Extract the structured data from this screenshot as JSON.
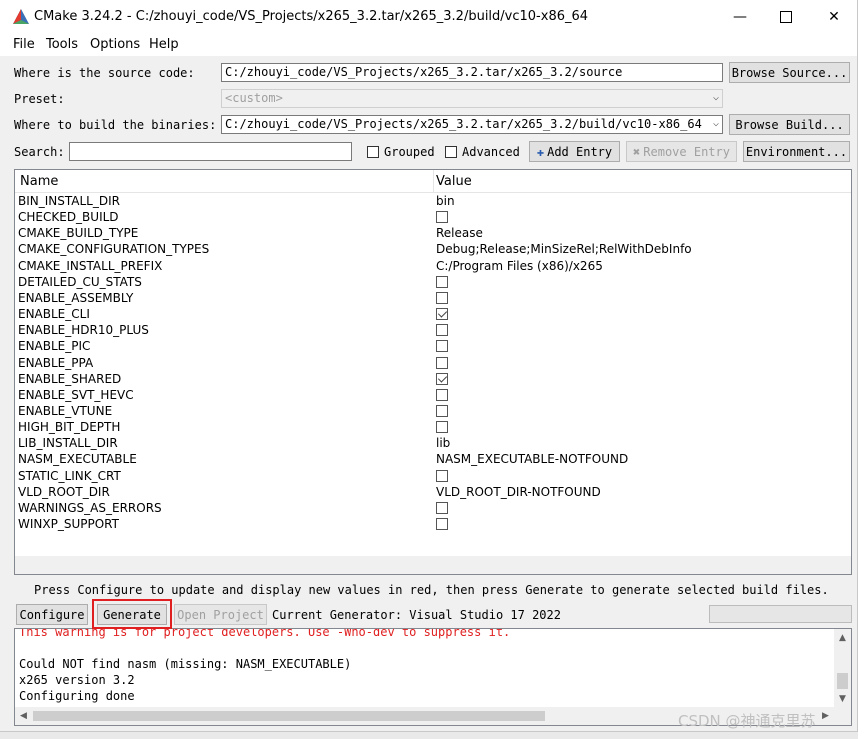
{
  "window": {
    "title": "CMake 3.24.2 - C:/zhouyi_code/VS_Projects/x265_3.2.tar/x265_3.2/build/vc10-x86_64"
  },
  "menu": [
    "File",
    "Tools",
    "Options",
    "Help"
  ],
  "source": {
    "label": "Where is the source code:",
    "value": "C:/zhouyi_code/VS_Projects/x265_3.2.tar/x265_3.2/source",
    "browse": "Browse Source..."
  },
  "preset": {
    "label": "Preset:",
    "value": "<custom>"
  },
  "build": {
    "label": "Where to build the binaries:",
    "value": "C:/zhouyi_code/VS_Projects/x265_3.2.tar/x265_3.2/build/vc10-x86_64",
    "browse": "Browse Build..."
  },
  "search": {
    "label": "Search:",
    "value": "",
    "grouped": "Grouped",
    "advanced": "Advanced",
    "add_entry": "Add Entry",
    "remove_entry": "Remove Entry",
    "environment": "Environment..."
  },
  "table": {
    "headers": [
      "Name",
      "Value"
    ],
    "rows": [
      {
        "name": "BIN_INSTALL_DIR",
        "value": "bin"
      },
      {
        "name": "CHECKED_BUILD",
        "value": ""
      },
      {
        "name": "CMAKE_BUILD_TYPE",
        "value": "Release"
      },
      {
        "name": "CMAKE_CONFIGURATION_TYPES",
        "value": "Debug;Release;MinSizeRel;RelWithDebInfo"
      },
      {
        "name": "CMAKE_INSTALL_PREFIX",
        "value": "C:/Program Files (x86)/x265"
      },
      {
        "name": "DETAILED_CU_STATS",
        "value": ""
      },
      {
        "name": "ENABLE_ASSEMBLY",
        "value": ""
      },
      {
        "name": "ENABLE_CLI",
        "value": ""
      },
      {
        "name": "ENABLE_HDR10_PLUS",
        "value": ""
      },
      {
        "name": "ENABLE_PIC",
        "value": ""
      },
      {
        "name": "ENABLE_PPA",
        "value": ""
      },
      {
        "name": "ENABLE_SHARED",
        "value": ""
      },
      {
        "name": "ENABLE_SVT_HEVC",
        "value": ""
      },
      {
        "name": "ENABLE_VTUNE",
        "value": ""
      },
      {
        "name": "HIGH_BIT_DEPTH",
        "value": ""
      },
      {
        "name": "LIB_INSTALL_DIR",
        "value": "lib"
      },
      {
        "name": "NASM_EXECUTABLE",
        "value": "NASM_EXECUTABLE-NOTFOUND"
      },
      {
        "name": "STATIC_LINK_CRT",
        "value": ""
      },
      {
        "name": "VLD_ROOT_DIR",
        "value": "VLD_ROOT_DIR-NOTFOUND"
      },
      {
        "name": "WARNINGS_AS_ERRORS",
        "value": ""
      },
      {
        "name": "WINXP_SUPPORT",
        "value": ""
      }
    ],
    "checkbox_rows": [
      1,
      5,
      6,
      7,
      8,
      9,
      10,
      11,
      12,
      13,
      14,
      17,
      19,
      20
    ],
    "checked_rows": [
      7,
      11
    ]
  },
  "hint": "Press Configure to update and display new values in red, then press Generate to generate selected build files.",
  "actions": {
    "configure": "Configure",
    "generate": "Generate",
    "open_project": "Open Project",
    "generator": "Current Generator: Visual Studio 17 2022"
  },
  "output": [
    {
      "text": "This warning is for project developers.  Use -Wno-dev to suppress it.",
      "color": "#e02020"
    },
    {
      "text": "",
      "color": "#000000"
    },
    {
      "text": "Could NOT find nasm (missing: NASM_EXECUTABLE)",
      "color": "#000000"
    },
    {
      "text": "x265 version 3.2",
      "color": "#000000"
    },
    {
      "text": "Configuring done",
      "color": "#000000"
    }
  ],
  "watermark": "CSDN @神通克里苏",
  "colors": {
    "accent": "#e02020",
    "selection_border": "#e02020"
  }
}
